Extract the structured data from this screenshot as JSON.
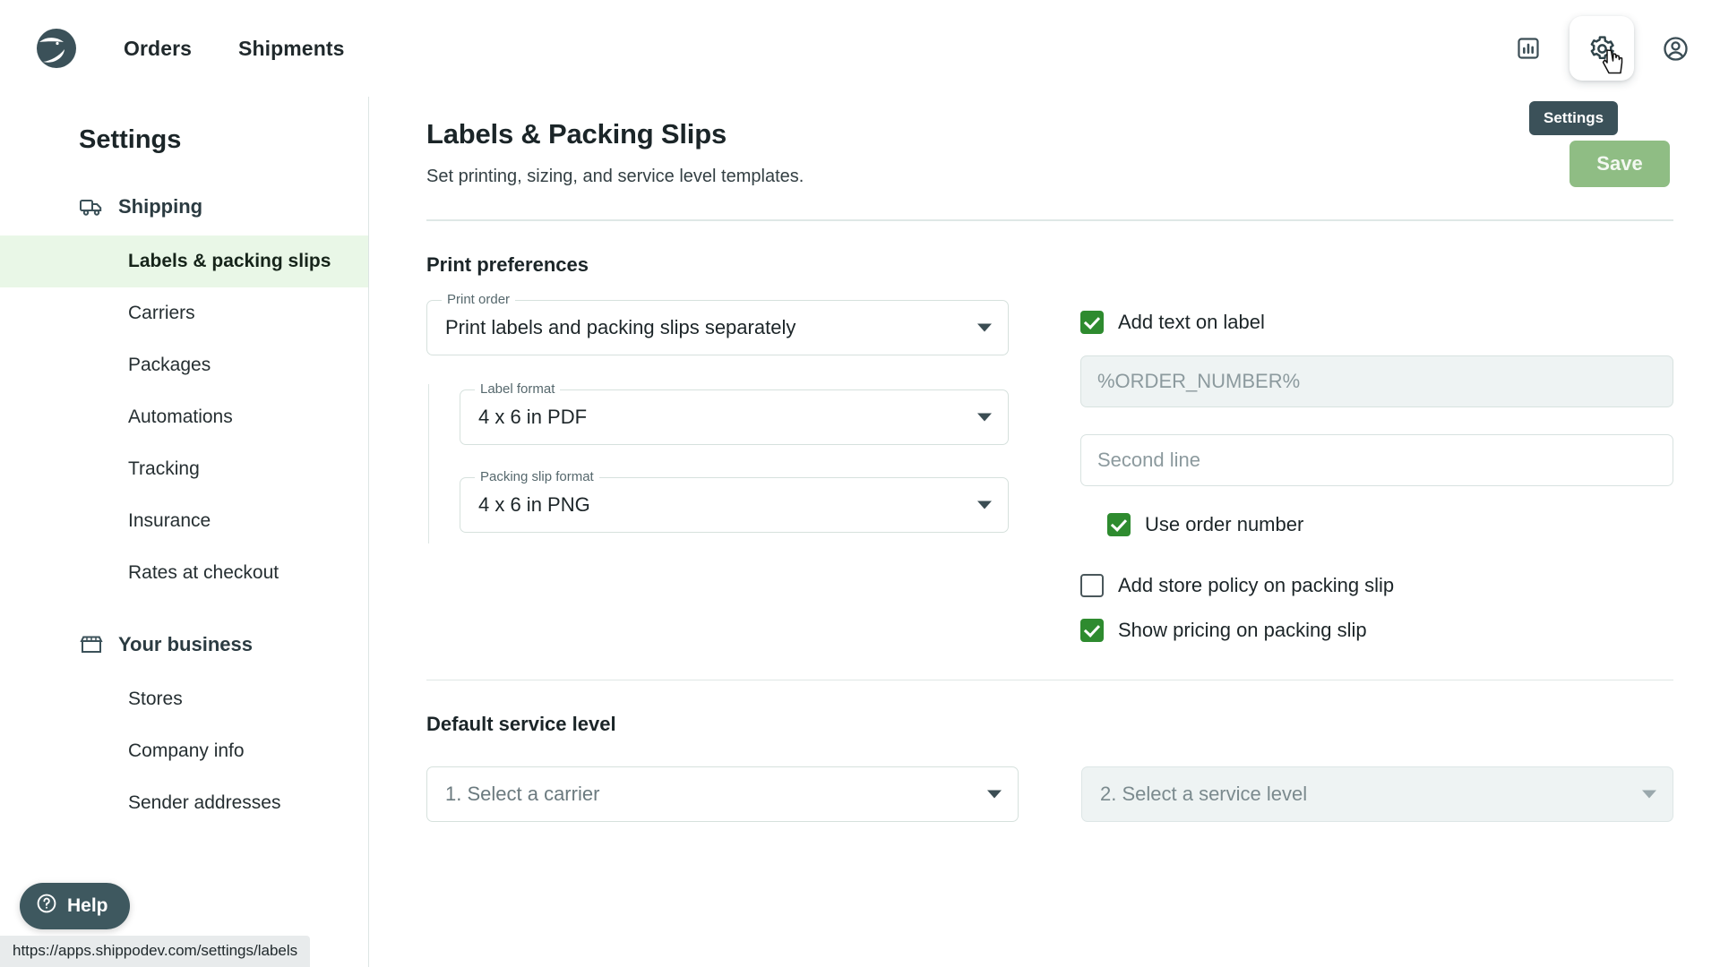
{
  "header": {
    "logo_name": "shippo-logo",
    "nav": [
      {
        "label": "Orders"
      },
      {
        "label": "Shipments"
      }
    ],
    "actions": [
      {
        "name": "analytics-icon",
        "label": "Analytics"
      },
      {
        "name": "gear-icon",
        "label": "Settings"
      },
      {
        "name": "account-icon",
        "label": "Account"
      }
    ],
    "tooltip": "Settings",
    "save_label": "Save"
  },
  "sidebar": {
    "title": "Settings",
    "groups": [
      {
        "label": "Shipping",
        "icon": "truck-icon",
        "items": [
          {
            "label": "Labels & packing slips",
            "active": true
          },
          {
            "label": "Carriers",
            "active": false
          },
          {
            "label": "Packages",
            "active": false
          },
          {
            "label": "Automations",
            "active": false
          },
          {
            "label": "Tracking",
            "active": false
          },
          {
            "label": "Insurance",
            "active": false
          },
          {
            "label": "Rates at checkout",
            "active": false
          }
        ]
      },
      {
        "label": "Your business",
        "icon": "storefront-icon",
        "items": [
          {
            "label": "Stores",
            "active": false
          },
          {
            "label": "Company info",
            "active": false
          },
          {
            "label": "Sender addresses",
            "active": false
          }
        ]
      }
    ]
  },
  "main": {
    "title": "Labels & Packing Slips",
    "subtitle": "Set printing, sizing, and service level templates.",
    "print_preferences": {
      "heading": "Print preferences",
      "print_order": {
        "label": "Print order",
        "value": "Print labels and packing slips separately"
      },
      "label_format": {
        "label": "Label format",
        "value": "4 x 6 in PDF"
      },
      "packing_slip_format": {
        "label": "Packing slip format",
        "value": "4 x 6 in PNG"
      },
      "add_text_on_label": {
        "label": "Add text on label",
        "checked": true
      },
      "first_line": {
        "value": "%ORDER_NUMBER%",
        "placeholder": "%ORDER_NUMBER%"
      },
      "second_line": {
        "value": "",
        "placeholder": "Second line"
      },
      "use_order_number": {
        "label": "Use order number",
        "checked": true
      },
      "add_store_policy": {
        "label": "Add store policy on packing slip",
        "checked": false
      },
      "show_pricing": {
        "label": "Show pricing on packing slip",
        "checked": true
      }
    },
    "default_service_level": {
      "heading": "Default service level",
      "carrier": {
        "value": "1. Select a carrier"
      },
      "service_level": {
        "value": "2. Select a service level"
      }
    }
  },
  "help": {
    "label": "Help",
    "icon": "question-circle-icon"
  },
  "status_bar": {
    "url": "https://apps.shippodev.com/settings/labels"
  },
  "colors": {
    "accent_green": "#2e8b2f",
    "save_green": "#8fbd84",
    "highlight_green": "#e9f7e7",
    "slate": "#3b5159"
  }
}
